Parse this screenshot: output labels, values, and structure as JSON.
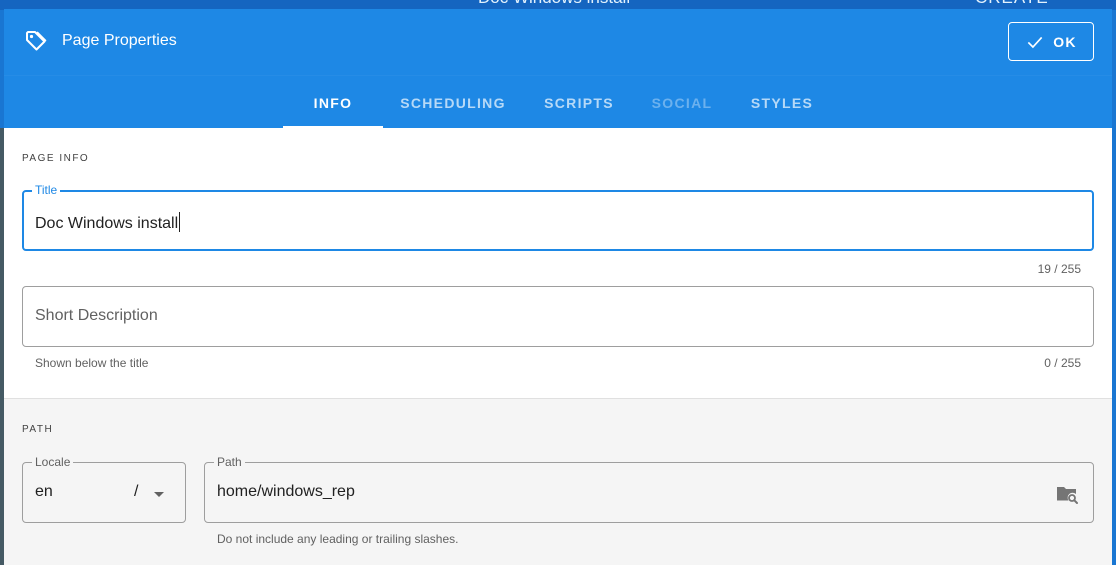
{
  "background": {
    "page_title": "Doc Windows install",
    "create_label": "CREATE"
  },
  "dialog": {
    "title": "Page Properties",
    "header_icon": "tag-icon",
    "ok_label": "OK",
    "ok_icon": "check-icon",
    "accent_color": "#1e88e5"
  },
  "tabs": [
    {
      "label": "INFO",
      "state": "active"
    },
    {
      "label": "SCHEDULING",
      "state": "normal"
    },
    {
      "label": "SCRIPTS",
      "state": "normal"
    },
    {
      "label": "SOCIAL",
      "state": "disabled"
    },
    {
      "label": "STYLES",
      "state": "normal"
    }
  ],
  "page_info": {
    "subheader": "PAGE INFO",
    "title_field": {
      "label": "Title",
      "value": "Doc Windows install",
      "counter": "19 / 255"
    },
    "description_field": {
      "placeholder": "Short Description",
      "hint": "Shown below the title",
      "counter": "0 / 255"
    }
  },
  "path_section": {
    "subheader": "PATH",
    "locale_field": {
      "label": "Locale",
      "value": "en",
      "separator": "/"
    },
    "path_field": {
      "label": "Path",
      "value": "home/windows_rep",
      "hint": "Do not include any leading or trailing slashes.",
      "icon": "folder-search-icon"
    }
  }
}
